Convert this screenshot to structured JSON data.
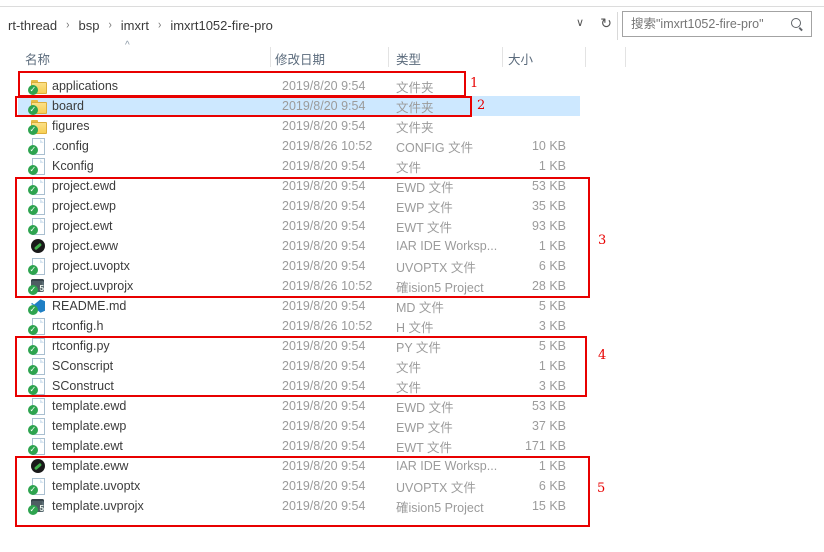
{
  "breadcrumb": {
    "items": [
      "rt-thread",
      "bsp",
      "imxrt",
      "imxrt1052-fire-pro"
    ],
    "separator": "›"
  },
  "toolbar": {
    "dropdown_glyph": "∨",
    "refresh_glyph": "↻",
    "search_placeholder": "搜索\"imxrt1052-fire-pro\""
  },
  "sort_caret": "^",
  "columns": [
    {
      "label": "名称"
    },
    {
      "label": "修改日期"
    },
    {
      "label": "类型"
    },
    {
      "label": "大小"
    }
  ],
  "files": [
    {
      "name": "applications",
      "date": "2019/8/20 9:54",
      "type": "文件夹",
      "size": "",
      "icon": "folder",
      "selected": false
    },
    {
      "name": "board",
      "date": "2019/8/20 9:54",
      "type": "文件夹",
      "size": "",
      "icon": "folder",
      "selected": true
    },
    {
      "name": "figures",
      "date": "2019/8/20 9:54",
      "type": "文件夹",
      "size": "",
      "icon": "folder",
      "selected": false
    },
    {
      "name": ".config",
      "date": "2019/8/26 10:52",
      "type": "CONFIG 文件",
      "size": "10 KB",
      "icon": "document",
      "selected": false
    },
    {
      "name": "Kconfig",
      "date": "2019/8/20 9:54",
      "type": "文件",
      "size": "1 KB",
      "icon": "document",
      "selected": false
    },
    {
      "name": "project.ewd",
      "date": "2019/8/20 9:54",
      "type": "EWD 文件",
      "size": "53 KB",
      "icon": "document",
      "selected": false
    },
    {
      "name": "project.ewp",
      "date": "2019/8/20 9:54",
      "type": "EWP 文件",
      "size": "35 KB",
      "icon": "document",
      "selected": false
    },
    {
      "name": "project.ewt",
      "date": "2019/8/20 9:54",
      "type": "EWT 文件",
      "size": "93 KB",
      "icon": "document",
      "selected": false
    },
    {
      "name": "project.eww",
      "date": "2019/8/20 9:54",
      "type": "IAR IDE Worksp...",
      "size": "1 KB",
      "icon": "iar-workbench",
      "selected": false
    },
    {
      "name": "project.uvoptx",
      "date": "2019/8/20 9:54",
      "type": "UVOPTX 文件",
      "size": "6 KB",
      "icon": "document",
      "selected": false
    },
    {
      "name": "project.uvprojx",
      "date": "2019/8/26 10:52",
      "type": "確ision5 Project",
      "size": "28 KB",
      "icon": "keil-uvision",
      "selected": false
    },
    {
      "name": "README.md",
      "date": "2019/8/20 9:54",
      "type": "MD 文件",
      "size": "5 KB",
      "icon": "vscode",
      "selected": false
    },
    {
      "name": "rtconfig.h",
      "date": "2019/8/26 10:52",
      "type": "H 文件",
      "size": "3 KB",
      "icon": "document",
      "selected": false
    },
    {
      "name": "rtconfig.py",
      "date": "2019/8/20 9:54",
      "type": "PY 文件",
      "size": "5 KB",
      "icon": "document",
      "selected": false
    },
    {
      "name": "SConscript",
      "date": "2019/8/20 9:54",
      "type": "文件",
      "size": "1 KB",
      "icon": "document",
      "selected": false
    },
    {
      "name": "SConstruct",
      "date": "2019/8/20 9:54",
      "type": "文件",
      "size": "3 KB",
      "icon": "document",
      "selected": false
    },
    {
      "name": "template.ewd",
      "date": "2019/8/20 9:54",
      "type": "EWD 文件",
      "size": "53 KB",
      "icon": "document",
      "selected": false
    },
    {
      "name": "template.ewp",
      "date": "2019/8/20 9:54",
      "type": "EWP 文件",
      "size": "37 KB",
      "icon": "document",
      "selected": false
    },
    {
      "name": "template.ewt",
      "date": "2019/8/20 9:54",
      "type": "EWT 文件",
      "size": "171 KB",
      "icon": "document",
      "selected": false
    },
    {
      "name": "template.eww",
      "date": "2019/8/20 9:54",
      "type": "IAR IDE Worksp...",
      "size": "1 KB",
      "icon": "iar-workbench",
      "selected": false
    },
    {
      "name": "template.uvoptx",
      "date": "2019/8/20 9:54",
      "type": "UVOPTX 文件",
      "size": "6 KB",
      "icon": "document",
      "selected": false
    },
    {
      "name": "template.uvprojx",
      "date": "2019/8/20 9:54",
      "type": "確ision5 Project",
      "size": "15 KB",
      "icon": "keil-uvision",
      "selected": false
    }
  ],
  "annotations": [
    {
      "label": "1"
    },
    {
      "label": "2"
    },
    {
      "label": "3"
    },
    {
      "label": "4"
    },
    {
      "label": "5"
    }
  ],
  "colors": {
    "annotation_red": "#e80000",
    "selected_row_bg": "#cde8ff",
    "vcs_badge_green": "#2ea44f",
    "folder_yellow": "#f7cf55"
  }
}
